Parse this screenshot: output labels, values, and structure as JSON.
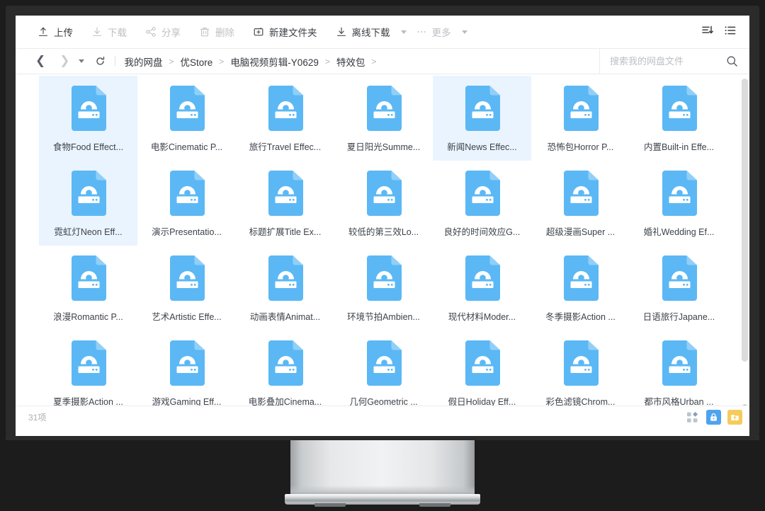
{
  "toolbar": {
    "items": [
      {
        "label": "上传",
        "icon": "upload-icon",
        "dim": false,
        "caret": false
      },
      {
        "label": "下载",
        "icon": "download-icon",
        "dim": true,
        "caret": false
      },
      {
        "label": "分享",
        "icon": "share-icon",
        "dim": true,
        "caret": false
      },
      {
        "label": "删除",
        "icon": "trash-icon",
        "dim": true,
        "caret": false
      },
      {
        "label": "新建文件夹",
        "icon": "new-folder-icon",
        "dim": false,
        "caret": false
      },
      {
        "label": "离线下载",
        "icon": "offline-download-icon",
        "dim": false,
        "caret": true
      },
      {
        "label": "更多",
        "icon": "more-dots-icon",
        "dim": true,
        "caret": true
      }
    ],
    "sort_icon": "sort-descending-icon",
    "view_icon": "list-view-icon"
  },
  "breadcrumb": {
    "back_icon": "chevron-left-icon",
    "forward_icon": "chevron-right-icon",
    "dropdown_icon": "caret-down-icon",
    "refresh_icon": "refresh-icon",
    "path": [
      "我的网盘",
      "优Store",
      "电脑视频剪辑-Y0629",
      "特效包"
    ],
    "separator": ">"
  },
  "search": {
    "placeholder": "搜索我的网盘文件",
    "value": "",
    "icon": "search-icon"
  },
  "files": [
    {
      "name": "食物Food Effect...",
      "selected": true
    },
    {
      "name": "电影Cinematic P...",
      "selected": false
    },
    {
      "name": "旅行Travel Effec...",
      "selected": false
    },
    {
      "name": "夏日阳光Summe...",
      "selected": false
    },
    {
      "name": "新闻News Effec...",
      "selected": true
    },
    {
      "name": "恐怖包Horror P...",
      "selected": false
    },
    {
      "name": "内置Built-in Effe...",
      "selected": false
    },
    {
      "name": "霓虹灯Neon Eff...",
      "selected": true
    },
    {
      "name": "演示Presentatio...",
      "selected": false
    },
    {
      "name": "标题扩展Title Ex...",
      "selected": false
    },
    {
      "name": "较低的第三效Lo...",
      "selected": false
    },
    {
      "name": "良好的时间效应G...",
      "selected": false
    },
    {
      "name": "超级漫画Super ...",
      "selected": false
    },
    {
      "name": "婚礼Wedding Ef...",
      "selected": false
    },
    {
      "name": "浪漫Romantic P...",
      "selected": false
    },
    {
      "name": "艺术Artistic Effe...",
      "selected": false
    },
    {
      "name": "动画表情Animat...",
      "selected": false
    },
    {
      "name": "环境节拍Ambien...",
      "selected": false
    },
    {
      "name": "现代材料Moder...",
      "selected": false
    },
    {
      "name": "冬季摄影Action ...",
      "selected": false
    },
    {
      "name": "日语旅行Japane...",
      "selected": false
    },
    {
      "name": "夏季摄影Action ...",
      "selected": false
    },
    {
      "name": "游戏Gaming Eff...",
      "selected": false
    },
    {
      "name": "电影叠加Cinema...",
      "selected": false
    },
    {
      "name": "几何Geometric ...",
      "selected": false
    },
    {
      "name": "假日Holiday Eff...",
      "selected": false
    },
    {
      "name": "彩色滤镜Chrom...",
      "selected": false
    },
    {
      "name": "都市风格Urban ...",
      "selected": false
    }
  ],
  "status": {
    "count_text": "31项",
    "actions": [
      {
        "icon": "grid-apps-icon",
        "style": "plain"
      },
      {
        "icon": "lock-icon",
        "style": "blue"
      },
      {
        "icon": "folder-upload-icon",
        "style": "yellow"
      }
    ]
  },
  "colors": {
    "file_icon_blue": "#5bb8f5",
    "selection_blue": "#eaf4fe",
    "accent_blue": "#4fa3ee",
    "accent_yellow": "#f5cc5b",
    "bezel": "#2b2b2b"
  }
}
